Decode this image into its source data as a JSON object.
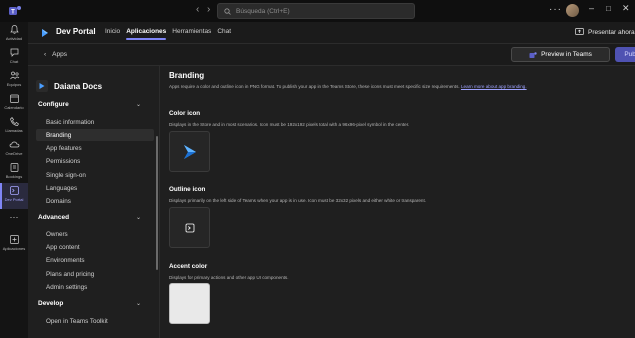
{
  "titlebar": {
    "search_placeholder": "Búsqueda (Ctrl+E)",
    "more": "···"
  },
  "rail": {
    "items": [
      {
        "label": "Actividad",
        "icon": "bell-icon"
      },
      {
        "label": "Chat",
        "icon": "chat-icon"
      },
      {
        "label": "Equipos",
        "icon": "teams-icon"
      },
      {
        "label": "Calendario",
        "icon": "calendar-icon"
      },
      {
        "label": "Llamadas",
        "icon": "phone-icon"
      },
      {
        "label": "OneDrive",
        "icon": "cloud-icon"
      },
      {
        "label": "Bookings",
        "icon": "bookings-icon"
      },
      {
        "label": "Dev Portal",
        "icon": "dev-portal-icon"
      },
      {
        "label": "···",
        "icon": "more-icon"
      },
      {
        "label": "Aplicaciones",
        "icon": "apps-icon"
      }
    ],
    "active_index": 7
  },
  "appheader": {
    "app_name": "Dev Portal",
    "tabs": [
      {
        "label": "Inicio",
        "selected": false
      },
      {
        "label": "Aplicaciones",
        "selected": true
      },
      {
        "label": "Herramientas",
        "selected": false
      },
      {
        "label": "Chat",
        "selected": false
      }
    ],
    "present_label": "Presentar ahora"
  },
  "toolbar": {
    "back_label": "Apps",
    "preview_label": "Preview in Teams",
    "publish_label": "Publish"
  },
  "nav": {
    "app_title": "Daiana Docs",
    "configure_label": "Configure",
    "configure_items": [
      "Basic information",
      "Branding",
      "App features",
      "Permissions",
      "Single sign-on",
      "Languages",
      "Domains"
    ],
    "selected_item": "Branding",
    "advanced_label": "Advanced",
    "advanced_items": [
      "Owners",
      "App content",
      "Environments",
      "Plans and pricing",
      "Admin settings"
    ],
    "develop_label": "Develop",
    "develop_items": [
      "Open in Teams Toolkit"
    ]
  },
  "main": {
    "title": "Branding",
    "intro": "Apps require a color and outline icon in PNG format. To publish your app in the Teams Store, these icons must meet specific size requirements.",
    "intro_link": "Learn more about app branding.",
    "color_icon": {
      "title": "Color icon",
      "desc": "Displays in the Store and in most scenarios. Icon must be 192x192 pixels total with a 96x96-pixel symbol in the center."
    },
    "outline_icon": {
      "title": "Outline icon",
      "desc": "Displays primarily on the left side of Teams when your app is in use. Icon must be 32x32 pixels and either white or transparent."
    },
    "accent_color": {
      "title": "Accent color",
      "desc": "Displays for primary actions and other app UI components.",
      "value": "#E9E9E9"
    }
  },
  "colors": {
    "accent": "#7F85F5",
    "publish_bg": "#4F52B2",
    "brand_blue": "#2F8FEF"
  }
}
